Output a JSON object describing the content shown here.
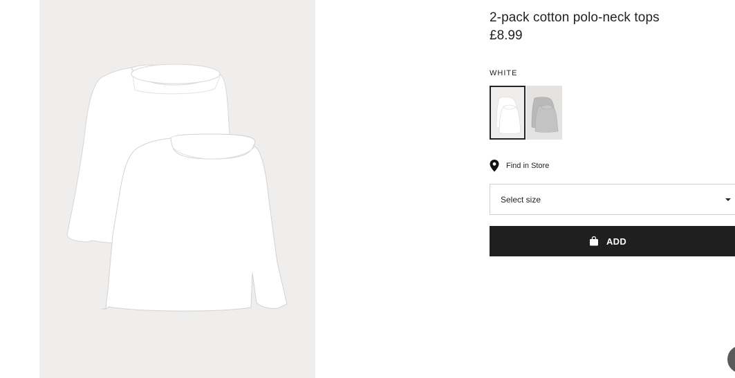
{
  "product": {
    "title": "2-pack cotton polo-neck tops",
    "price": "£8.99",
    "image_alt": "Two white long-sleeved polo-neck tops"
  },
  "color": {
    "selected_name": "WHITE",
    "swatches": [
      {
        "name": "White",
        "selected": true,
        "color": "#ffffff"
      },
      {
        "name": "Grey marl",
        "selected": false,
        "color": "#bdbdbd"
      }
    ]
  },
  "store": {
    "find_in_store_label": "Find in Store",
    "icon": "location-pin-icon"
  },
  "size": {
    "placeholder": "Select size",
    "icon": "caret-down-icon"
  },
  "add": {
    "label": "ADD",
    "icon": "shopping-bag-icon"
  },
  "colors": {
    "button_bg": "#1f1f1f",
    "image_bg": "#efeeec",
    "text": "#222222"
  }
}
